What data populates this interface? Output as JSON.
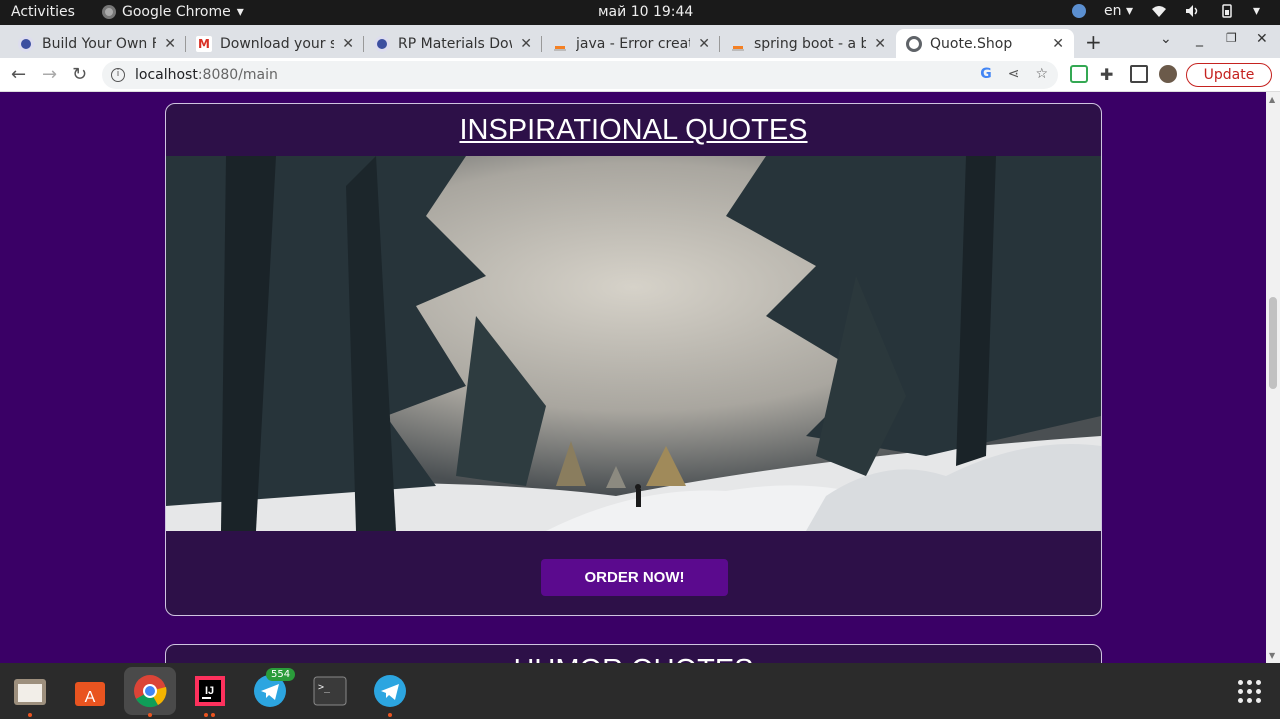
{
  "topbar": {
    "activities": "Activities",
    "app_name": "Google Chrome",
    "app_menu_arrow": "▾",
    "clock": "май 10  19:44",
    "language": "en",
    "language_arrow": "▾"
  },
  "tabs": [
    {
      "title": "Build Your Own Fa",
      "favicon": "globe-icon",
      "color": "#3c4fa0"
    },
    {
      "title": "Download your so",
      "favicon": "gmail-icon",
      "color": "#d93025"
    },
    {
      "title": "RP Materials Dow",
      "favicon": "globe-icon",
      "color": "#3c4fa0"
    },
    {
      "title": "java - Error creatin",
      "favicon": "stackoverflow-icon",
      "color": "#f48024"
    },
    {
      "title": "spring boot - a bea",
      "favicon": "stackoverflow-icon",
      "color": "#f48024"
    },
    {
      "title": "Quote.Shop",
      "favicon": "globe-icon",
      "color": "#5f6368",
      "active": true
    }
  ],
  "tab_close": "✕",
  "toolbar": {
    "url_host": "localhost",
    "url_rest": ":8080/main",
    "update_label": "Update"
  },
  "page": {
    "card1_title": "INSPIRATIONAL QUOTES",
    "order_button": "ORDER NOW!",
    "card2_title": "HUMOR QUOTES"
  },
  "dock": {
    "telegram_badge": "554"
  },
  "colors": {
    "page_bg": "#3a0066",
    "card_bg": "#2d1048",
    "button_bg": "#5b0a8e",
    "update_red": "#c5221f"
  }
}
